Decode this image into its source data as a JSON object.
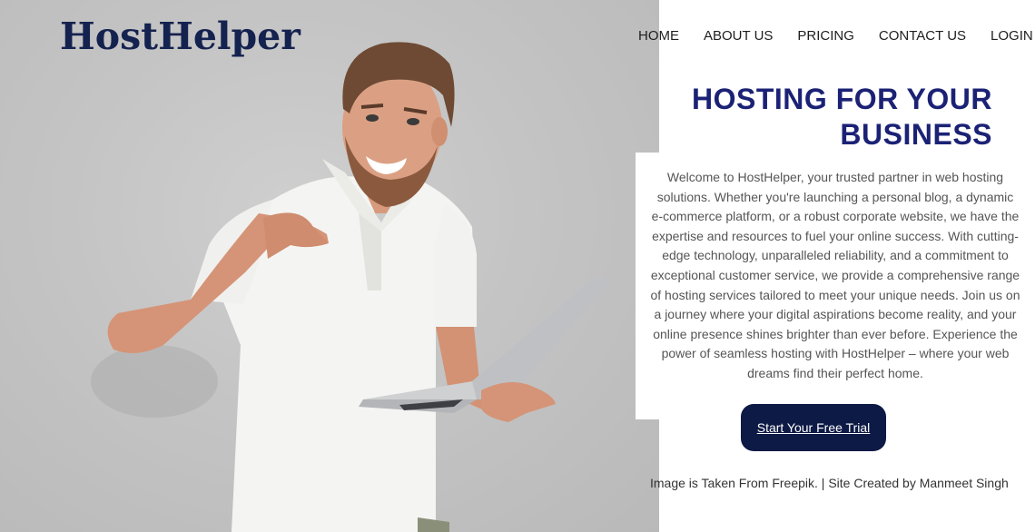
{
  "brand": {
    "logo": "HostHelper"
  },
  "nav": {
    "items": [
      {
        "label": "HOME"
      },
      {
        "label": "ABOUT US"
      },
      {
        "label": "PRICING"
      },
      {
        "label": "CONTACT US"
      },
      {
        "label": "LOGIN"
      }
    ]
  },
  "hero": {
    "headline_line1": "HOSTING FOR YOUR",
    "headline_line2": "BUSINESS",
    "intro": "Welcome to HostHelper, your trusted partner in web hosting solutions. Whether you're launching a personal blog, a dynamic e-commerce platform, or a robust corporate website, we have the expertise and resources to fuel your online success. With cutting-edge technology, unparalleled reliability, and a commitment to exceptional customer service, we provide a comprehensive range of hosting services tailored to meet your unique needs. Join us on a journey where your digital aspirations become reality, and your online presence shines brighter than ever before. Experience the power of seamless hosting with HostHelper – where your web dreams find their perfect home.",
    "cta_label": "Start Your Free Trial"
  },
  "footer": {
    "credit": "Image is Taken From Freepik. | Site Created by Manmeet Singh"
  },
  "colors": {
    "brand_navy": "#14224f",
    "headline_blue": "#1b2275",
    "cta_background": "#0d1a45",
    "photo_background": "#c4c4c4"
  }
}
